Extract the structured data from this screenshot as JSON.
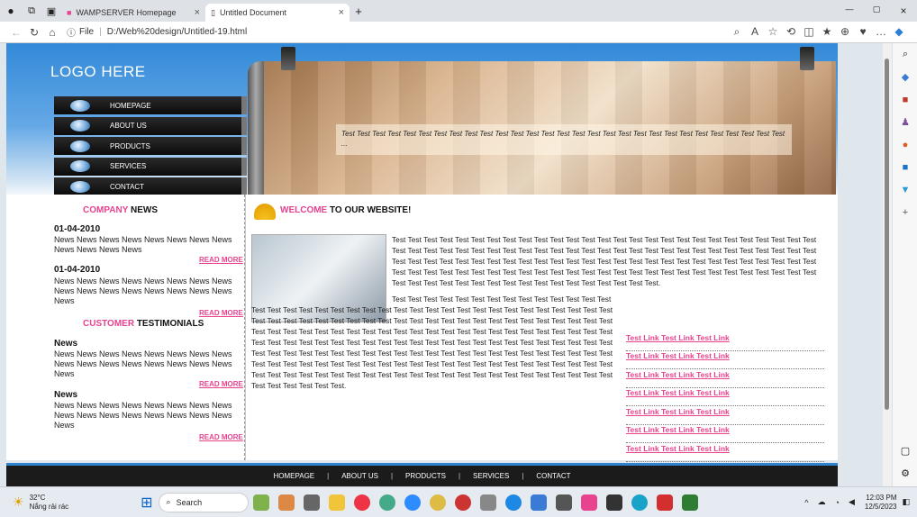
{
  "browser": {
    "tabs": [
      {
        "title": "WAMPSERVER Homepage"
      },
      {
        "title": "Untitled Document"
      }
    ],
    "url_prefix": "File",
    "url": "D:/Web%20design/Untitled-19.html"
  },
  "site": {
    "logo": "LOGO HERE",
    "nav": [
      "HOMEPAGE",
      "ABOUT US",
      "PRODUCTS",
      "SERVICES",
      "CONTACT"
    ],
    "banner_caption": "Test Test Test Test Test Test Test Test Test Test Test Test Test Test Test Test Test Test Test Test Test Test Test Test Test Test Test Test Test ...",
    "company_news_title_a": "COMPANY",
    "company_news_title_b": "NEWS",
    "news": [
      {
        "date": "01-04-2010",
        "text": "News News News News News News News News News News News News",
        "more": "READ MORE"
      },
      {
        "date": "01-04-2010",
        "text": "News News News News News News News News News News News News News News News News News",
        "more": "READ MORE"
      }
    ],
    "testimonials_title_a": "CUSTOMER",
    "testimonials_title_b": "TESTIMONIALS",
    "testimonials": [
      {
        "title": "News",
        "text": "News News News News News News News News News News News News News News News News News",
        "more": "READ MORE"
      },
      {
        "title": "News",
        "text": "News News News News News News News News News News News News News News News News News",
        "more": "READ MORE"
      }
    ],
    "welcome_a": "WELCOME",
    "welcome_b": "TO OUR WEBSITE!",
    "para1": "Test Test Test Test Test Test Test Test Test Test Test Test Test Test Test Test Test Test Test Test Test Test Test Test Test Test Test Test Test Test Test Test Test Test Test Test Test Test Test Test Test Test Test Test Test Test Test Test Test Test Test Test Test Test Test Test Test Test Test Test Test Test Test Test Test Test Test Test Test Test Test Test Test Test Test Test Test Test Test Test Test Test Test Test Test Test Test Test Test Test Test Test Test Test Test Test Test Test Test Test Test Test Test Test Test Test Test Test Test Test Test Test Test Test Test Test Test Test Test Test Test Test Test Test Test.",
    "para2": "Test Test Test Test Test Test Test Test Test Test Test Test Test Test Test Test Test Test Test Test Test Test Test Test Test Test Test Test Test Test Test Test Test Test Test Test Test Test Test Test Test Test Test Test Test Test Test Test Test Test Test Test Test Test Test Test Test Test Test Test Test Test Test Test Test Test Test Test Test Test Test Test Test Test Test Test Test Test Test Test Test Test Test Test Test Test Test Test Test Test Test Test Test Test Test Test Test Test Test Test Test Test Test Test Test Test Test Test Test Test Test Test Test Test Test Test Test Test Test Test Test Test Test Test Test Test Test Test Test Test Test Test Test Test Test Test Test Test Test Test Test Test Test Test Test Test Test Test Test Test Test Test Test Test Test Test Test Test Test Test Test Test Test Test Test Test Test Test Test Test Test Test Test Test Test Test Test Test Test Test Test.",
    "links": [
      "Test Link Test Link Test Link",
      "Test Link Test Link Test Link",
      "Test Link Test Link Test Link",
      "Test Link Test Link Test Link",
      "Test Link Test Link Test Link",
      "Test Link Test Link Test Link",
      "Test Link Test Link Test Link"
    ],
    "footer": [
      "HOMEPAGE",
      "ABOUT US",
      "PRODUCTS",
      "SERVICES",
      "CONTACT"
    ]
  },
  "taskbar": {
    "weather_temp": "32°C",
    "weather_desc": "Nắng rải rác",
    "search": "Search",
    "time": "12:03 PM",
    "date": "12/5/2023"
  },
  "colors": {
    "accent": "#e8438f",
    "header": "#3289d8",
    "footer": "#1b1b1b"
  }
}
